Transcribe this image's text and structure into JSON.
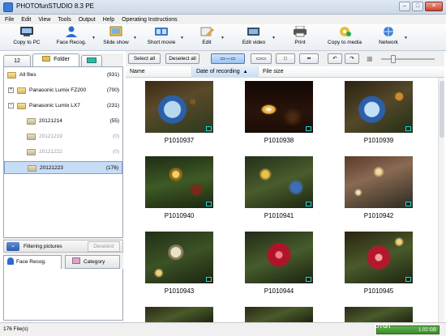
{
  "window": {
    "title": "PHOTOfunSTUDIO 8.3 PE"
  },
  "menu": [
    "File",
    "Edit",
    "View",
    "Tools",
    "Output",
    "Help",
    "Operating Instructions"
  ],
  "toolbar": [
    {
      "label": "Copy to PC",
      "icon": "copy-to-pc-icon",
      "dropdown": false
    },
    {
      "label": "Face Recog.",
      "icon": "face-recog-icon",
      "dropdown": true
    },
    {
      "label": "Slide show",
      "icon": "slideshow-icon",
      "dropdown": true
    },
    {
      "label": "Short movie",
      "icon": "short-movie-icon",
      "dropdown": true
    },
    {
      "label": "Edit",
      "icon": "edit-icon",
      "dropdown": true
    },
    {
      "label": "Edit video",
      "icon": "edit-video-icon",
      "dropdown": true
    },
    {
      "label": "Print",
      "icon": "print-icon",
      "dropdown": false
    },
    {
      "label": "Copy to media",
      "icon": "copy-to-media-icon",
      "dropdown": false
    },
    {
      "label": "Network",
      "icon": "network-icon",
      "dropdown": true
    }
  ],
  "sidebar": {
    "tab_number": "12",
    "tab_folder": "Folder",
    "tree": [
      {
        "label": "All files",
        "count": "(931)",
        "level": 0,
        "expander": "",
        "state": "normal"
      },
      {
        "label": "Panasonic Lumix FZ200",
        "count": "(700)",
        "level": 1,
        "expander": "+",
        "state": "normal"
      },
      {
        "label": "Panasonic Lumix LX7",
        "count": "(231)",
        "level": 1,
        "expander": "−",
        "state": "normal"
      },
      {
        "label": "20121214",
        "count": "(55)",
        "level": 2,
        "expander": "",
        "state": "normal"
      },
      {
        "label": "20121219",
        "count": "(0)",
        "level": 2,
        "expander": "",
        "state": "dim"
      },
      {
        "label": "20121222",
        "count": "(0)",
        "level": 2,
        "expander": "",
        "state": "dim"
      },
      {
        "label": "20121223",
        "count": "(176)",
        "level": 2,
        "expander": "",
        "state": "selected"
      }
    ],
    "filter_label": "Filtering pictures",
    "deselect_label": "Deselect",
    "filter_tabs": [
      "Face Recog.",
      "Category"
    ]
  },
  "content": {
    "select_all": "Select all",
    "deselect_all": "Deselect all",
    "columns": [
      "Name",
      "Date of recording",
      "File size"
    ],
    "sort_indicator": "▲",
    "thumbnails": [
      {
        "name": "P1010937"
      },
      {
        "name": "P1010938"
      },
      {
        "name": "P1010939"
      },
      {
        "name": "P1010940"
      },
      {
        "name": "P1010941"
      },
      {
        "name": "P1010942"
      },
      {
        "name": "P1010943"
      },
      {
        "name": "P1010944"
      },
      {
        "name": "P1010945"
      }
    ]
  },
  "status": {
    "file_count": "176 File(s)",
    "storage": "1.02 GB",
    "storage_color": "#4ea23a"
  },
  "watermark": "DIGI"
}
